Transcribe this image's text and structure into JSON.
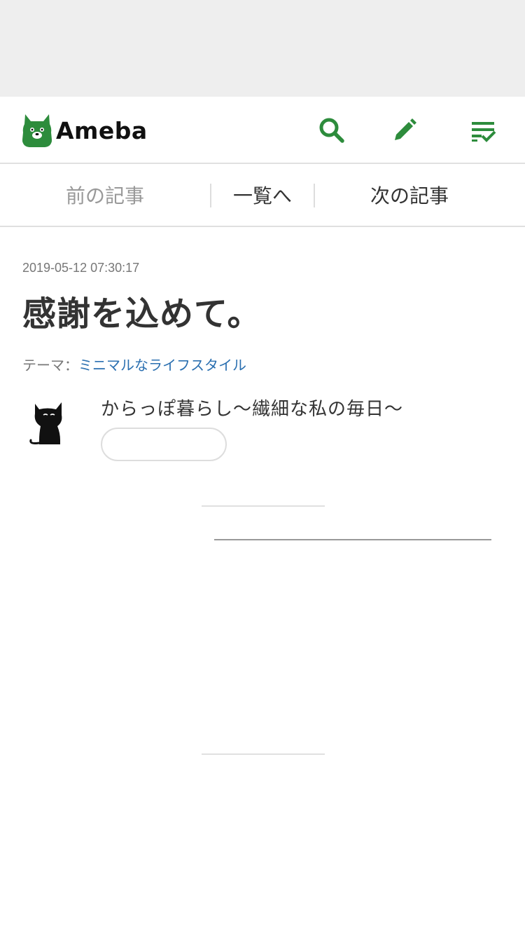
{
  "colors": {
    "brand_green": "#2d8c3c",
    "link_blue": "#2a6fb0",
    "top_bar_gray": "#eeeeee"
  },
  "header": {
    "logo_text": "Ameba",
    "logo_icon": "ameba-mascot-icon",
    "search_icon": "search-icon",
    "write_icon": "pencil-icon",
    "reader_icon": "checklist-icon"
  },
  "nav": {
    "prev_label": "前の記事",
    "list_label": "一覧へ",
    "next_label": "次の記事"
  },
  "article": {
    "date": "2019-05-12 07:30:17",
    "title": "感謝を込めて。",
    "theme_label": "テーマ：",
    "theme_value": "ミニマルなライフスタイル"
  },
  "author": {
    "avatar_icon": "black-cat-icon",
    "blog_name": "からっぽ暮らし〜繊細な私の毎日〜",
    "follow_button_label": ""
  }
}
